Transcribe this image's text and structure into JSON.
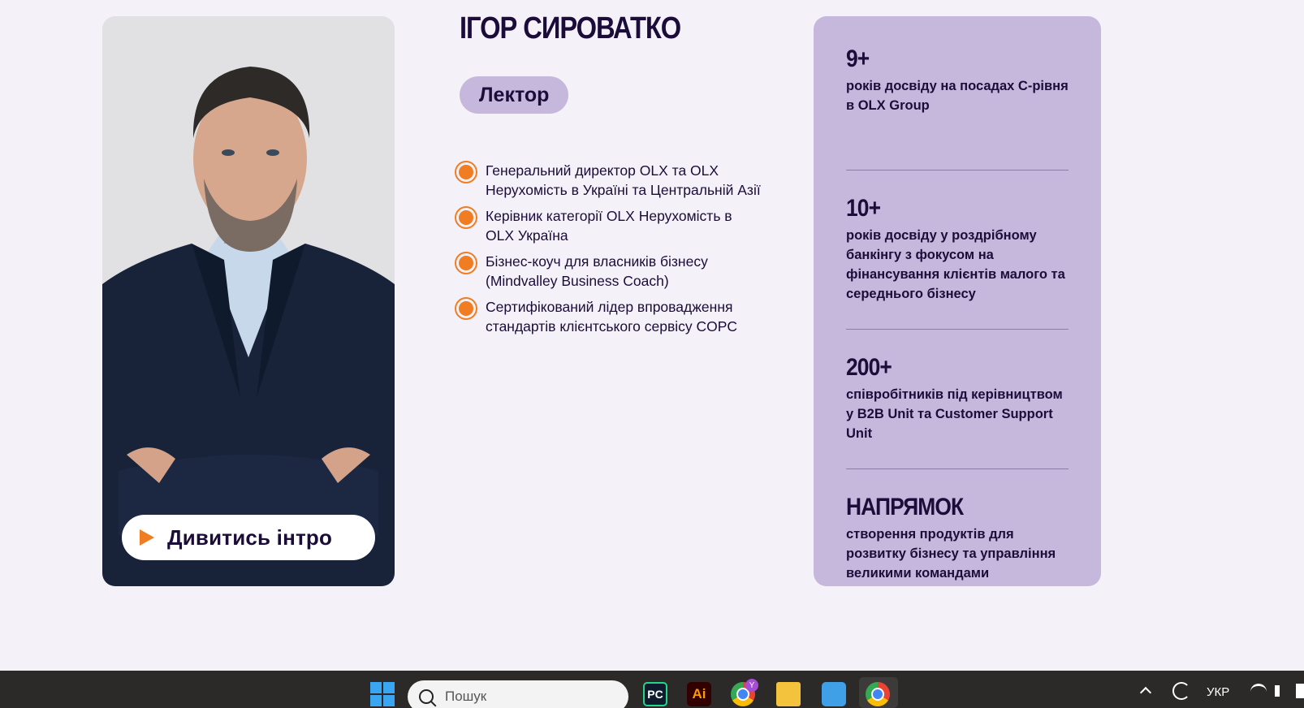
{
  "speaker": {
    "name": "ІГОР СИРОВАТКО",
    "role": "Лектор",
    "intro_button": "Дивитись інтро",
    "bullets": [
      "Генеральний директор OLX та OLX Нерухомість в Україні та Центральній Азії",
      "Керівник категорії OLX Нерухомість в OLX Україна",
      "Бізнес-коуч для власників бізнесу (Mindvalley Business Coach)",
      "Сертифікований лідер впровадження стандартів клієнтського сервісу COPC"
    ]
  },
  "stats": [
    {
      "value": "9+",
      "description": "років досвіду на посадах C-рівня в OLX Group"
    },
    {
      "value": "10+",
      "description": "років досвіду у роздрібному банкінгу з фокусом на фінансування клієнтів малого та середнього бізнесу"
    },
    {
      "value": "200+",
      "description": "співробітників під керівництвом у B2B Unit та Customer Support Unit"
    },
    {
      "value": "НАПРЯМОК",
      "description": "створення продуктів для розвитку бізнесу та управління великими командами"
    }
  ],
  "taskbar": {
    "search_placeholder": "Пошук",
    "language": "УКР",
    "apps": [
      "windows-start-icon",
      "pycharm-icon",
      "illustrator-icon",
      "chrome-icon",
      "file-explorer-icon",
      "notepad-icon",
      "chrome-icon"
    ],
    "illustrator_label": "Ai",
    "pycharm_label": "PC",
    "chrome_badge": "Y"
  },
  "colors": {
    "accent_orange": "#f07d22",
    "lavender": "#c6b8dc",
    "ink": "#1b0c3a",
    "page_bg": "#f4f2f8"
  }
}
